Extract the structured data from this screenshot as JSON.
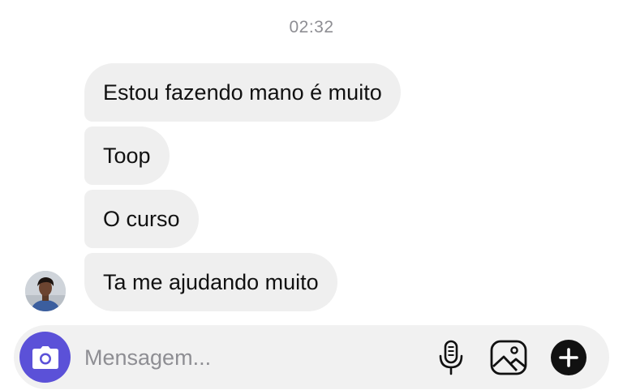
{
  "conversation": {
    "timestamp": "02:32",
    "messages": [
      {
        "text": "Estou fazendo mano é muito"
      },
      {
        "text": "Toop"
      },
      {
        "text": "O curso"
      },
      {
        "text": "Ta me ajudando muito"
      }
    ]
  },
  "composer": {
    "placeholder": "Mensagem...",
    "camera_icon": "camera-icon",
    "mic_icon": "microphone-icon",
    "gallery_icon": "image-gallery-icon",
    "add_icon": "plus-circle-icon"
  },
  "colors": {
    "bubble": "#efefef",
    "accent": "#5b51d8",
    "timestamp": "#8e8e93"
  }
}
